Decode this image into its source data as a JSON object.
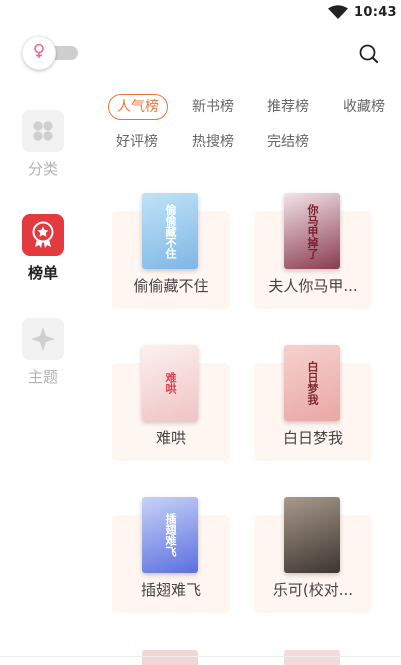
{
  "status": {
    "time": "10:43"
  },
  "sidebar": {
    "items": [
      {
        "label": "分类",
        "icon": "category-icon"
      },
      {
        "label": "榜单",
        "icon": "ranking-icon"
      },
      {
        "label": "主题",
        "icon": "theme-icon"
      }
    ]
  },
  "tabs": [
    {
      "label": "人气榜"
    },
    {
      "label": "新书榜"
    },
    {
      "label": "推荐榜"
    },
    {
      "label": "收藏榜"
    },
    {
      "label": "好评榜"
    },
    {
      "label": "热搜榜"
    },
    {
      "label": "完结榜"
    }
  ],
  "books": [
    {
      "title": "偷偷藏不住",
      "cover_text": "偷偷藏不住",
      "colors": [
        "#bfe3f7",
        "#7fb6e6"
      ],
      "text_color": "#ffffff"
    },
    {
      "title": "夫人你马甲...",
      "cover_text": "你马甲掉了",
      "colors": [
        "#f3e4ea",
        "#8a3b4f"
      ],
      "text_color": "#7a1f33"
    },
    {
      "title": "难哄",
      "cover_text": "难哄",
      "colors": [
        "#fbf1ef",
        "#f0c3c3"
      ],
      "text_color": "#d8434f"
    },
    {
      "title": "白日梦我",
      "cover_text": "白日梦我",
      "colors": [
        "#f6d1cf",
        "#e9a7a3"
      ],
      "text_color": "#7b2d30"
    },
    {
      "title": "插翅难飞",
      "cover_text": "插翅难飞",
      "colors": [
        "#c7d3f7",
        "#5b6fe0"
      ],
      "text_color": "#ffffff"
    },
    {
      "title": "乐可(校对...",
      "cover_text": "",
      "colors": [
        "#a89a8c",
        "#3e3530"
      ],
      "text_color": "#ffffff"
    }
  ],
  "colors": {
    "accent": "#e8763a",
    "active_sidebar": "#e23a3f",
    "card_bg": "#fff5f1"
  }
}
